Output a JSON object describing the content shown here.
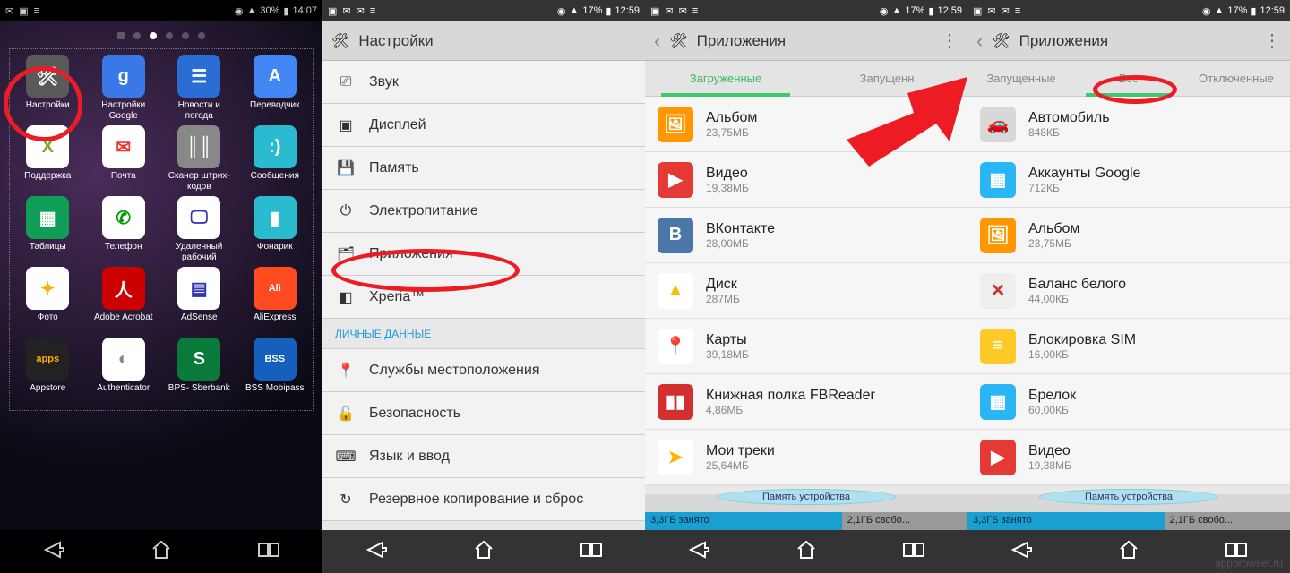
{
  "panel1": {
    "status": {
      "battery": "30%",
      "time": "14:07"
    },
    "apps": [
      {
        "label": "Настройки",
        "bg": "#5a5a5a",
        "g": "🛠"
      },
      {
        "label": "Настройки\nGoogle",
        "bg": "#3b78e7",
        "g": "g"
      },
      {
        "label": "Новости и\nпогода",
        "bg": "#2a6dd4",
        "g": "☰"
      },
      {
        "label": "Переводчик",
        "bg": "#4285f4",
        "g": "A"
      },
      {
        "label": "Поддержка",
        "bg": "#ffffff",
        "g": "X",
        "fg": "#7a2"
      },
      {
        "label": "Почта",
        "bg": "#ffffff",
        "g": "✉",
        "fg": "#e33"
      },
      {
        "label": "Сканер\nштрих-кодов",
        "bg": "#888",
        "g": "║║"
      },
      {
        "label": "Сообщения",
        "bg": "#2bbbd0",
        "g": ":)"
      },
      {
        "label": "Таблицы",
        "bg": "#0f9d58",
        "g": "▦"
      },
      {
        "label": "Телефон",
        "bg": "#fff",
        "g": "✆",
        "fg": "#090"
      },
      {
        "label": "Удаленный\nрабочий",
        "bg": "#fff",
        "g": "🖵",
        "fg": "#33a"
      },
      {
        "label": "Фонарик",
        "bg": "#2bbbd0",
        "g": "▮"
      },
      {
        "label": "Фото",
        "bg": "#fff",
        "g": "✦",
        "fg": "#f4b400"
      },
      {
        "label": "Adobe\nAcrobat",
        "bg": "#c00",
        "g": "人"
      },
      {
        "label": "AdSense",
        "bg": "#fff",
        "g": "▤",
        "fg": "#33a"
      },
      {
        "label": "AliExpress",
        "bg": "#ff4b1f",
        "g": "Ali"
      },
      {
        "label": "Appstore",
        "bg": "#222",
        "g": "apps",
        "fg": "#fa0"
      },
      {
        "label": "Authenticator",
        "bg": "#fff",
        "g": "◐",
        "fg": "#888"
      },
      {
        "label": "BPS-\nSberbank",
        "bg": "#0a7a3b",
        "g": "S"
      },
      {
        "label": "BSS\nMobipass",
        "bg": "#1560bd",
        "g": "BSS"
      }
    ]
  },
  "panel2": {
    "status": {
      "battery": "17%",
      "time": "12:59"
    },
    "title": "Настройки",
    "items": [
      {
        "label": "Звук",
        "icon": "⎚"
      },
      {
        "label": "Дисплей",
        "icon": "▣"
      },
      {
        "label": "Память",
        "icon": "💾"
      },
      {
        "label": "Электропитание",
        "icon": "⏻"
      },
      {
        "label": "Приложения",
        "icon": "🗂"
      },
      {
        "label": "Xperia™",
        "icon": "◧"
      }
    ],
    "section": "ЛИЧНЫЕ ДАННЫЕ",
    "items2": [
      {
        "label": "Службы местоположения",
        "icon": "📍"
      },
      {
        "label": "Безопасность",
        "icon": "🔓"
      },
      {
        "label": "Язык и ввод",
        "icon": "⌨"
      },
      {
        "label": "Резервное копирование и сброс",
        "icon": "↻"
      }
    ]
  },
  "panel3": {
    "status": {
      "battery": "17%",
      "time": "12:59"
    },
    "title": "Приложения",
    "tabs": [
      "Загруженные",
      "Запущенн"
    ],
    "activeTab": 0,
    "apps": [
      {
        "name": "Альбом",
        "size": "23,75МБ",
        "bg": "#ff9800",
        "g": "🖼"
      },
      {
        "name": "Видео",
        "size": "19,38МБ",
        "bg": "#e53935",
        "g": "▶"
      },
      {
        "name": "ВКонтакте",
        "size": "28,00МБ",
        "bg": "#4a76a8",
        "g": "B"
      },
      {
        "name": "Диск",
        "size": "287МБ",
        "bg": "#fff",
        "g": "▲",
        "fg": "#fbbc05"
      },
      {
        "name": "Карты",
        "size": "39,18МБ",
        "bg": "#fff",
        "g": "📍",
        "fg": "#ea4335"
      },
      {
        "name": "Книжная полка FBReader",
        "size": "4,86МБ",
        "bg": "#d32f2f",
        "g": "▮▮"
      },
      {
        "name": "Мои треки",
        "size": "25,64МБ",
        "bg": "#fff",
        "g": "➤",
        "fg": "#ffb300"
      }
    ],
    "storage": {
      "label": "Память устройства",
      "used": "3,3ГБ занято",
      "free": "2,1ГБ свобо...",
      "usedPct": 61
    }
  },
  "panel4": {
    "status": {
      "battery": "17%",
      "time": "12:59"
    },
    "title": "Приложения",
    "tabs": [
      "Запущенные",
      "Все",
      "Отключенные"
    ],
    "activeTab": 1,
    "apps": [
      {
        "name": "Автомобиль",
        "size": "848КБ",
        "bg": "#d8d8d8",
        "g": "🚗",
        "fg": "#666"
      },
      {
        "name": "Аккаунты Google",
        "size": "712КБ",
        "bg": "#29b6f6",
        "g": "▦"
      },
      {
        "name": "Альбом",
        "size": "23,75МБ",
        "bg": "#ff9800",
        "g": "🖼"
      },
      {
        "name": "Баланс белого",
        "size": "44,00КБ",
        "bg": "#eee",
        "g": "✕",
        "fg": "#c33"
      },
      {
        "name": "Блокировка SIM",
        "size": "16,00КБ",
        "bg": "#ffca28",
        "g": "≡"
      },
      {
        "name": "Брелок",
        "size": "60,00КБ",
        "bg": "#29b6f6",
        "g": "▦"
      },
      {
        "name": "Видео",
        "size": "19,38МБ",
        "bg": "#e53935",
        "g": "▶"
      }
    ],
    "storage": {
      "label": "Память устройства",
      "used": "3,3ГБ занято",
      "free": "2,1ГБ свобо...",
      "usedPct": 61
    }
  },
  "watermark": "appbrowser.ru"
}
